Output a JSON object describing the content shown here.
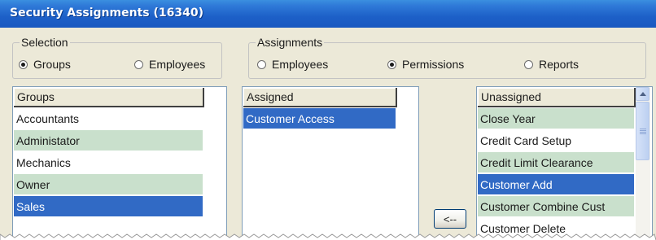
{
  "window": {
    "title": "Security Assignments (16340)"
  },
  "selection": {
    "legend": "Selection",
    "options": [
      {
        "label": "Groups",
        "selected": true
      },
      {
        "label": "Employees",
        "selected": false
      }
    ]
  },
  "assignments": {
    "legend": "Assignments",
    "options": [
      {
        "label": "Employees",
        "selected": false
      },
      {
        "label": "Permissions",
        "selected": true
      },
      {
        "label": "Reports",
        "selected": false
      }
    ]
  },
  "groups_list": {
    "header": "Groups",
    "rows": [
      "Accountants",
      "Administator",
      "Mechanics",
      "Owner",
      "Sales"
    ],
    "selected_index": 4
  },
  "assigned_list": {
    "header": "Assigned",
    "rows": [
      "Customer Access"
    ],
    "selected_index": 0
  },
  "move_button": {
    "label": "<--"
  },
  "unassigned_list": {
    "header": "Unassigned",
    "rows": [
      "Close Year",
      "Credit Card Setup",
      "Credit Limit Clearance",
      "Customer Add",
      "Customer Combine Cust",
      "Customer Delete"
    ],
    "selected_index": 3
  },
  "colors": {
    "title_bar": "#1d60c8",
    "selection_highlight": "#316ac5",
    "alternate_row": "#c9e0cc",
    "window_background": "#ece9d8"
  }
}
